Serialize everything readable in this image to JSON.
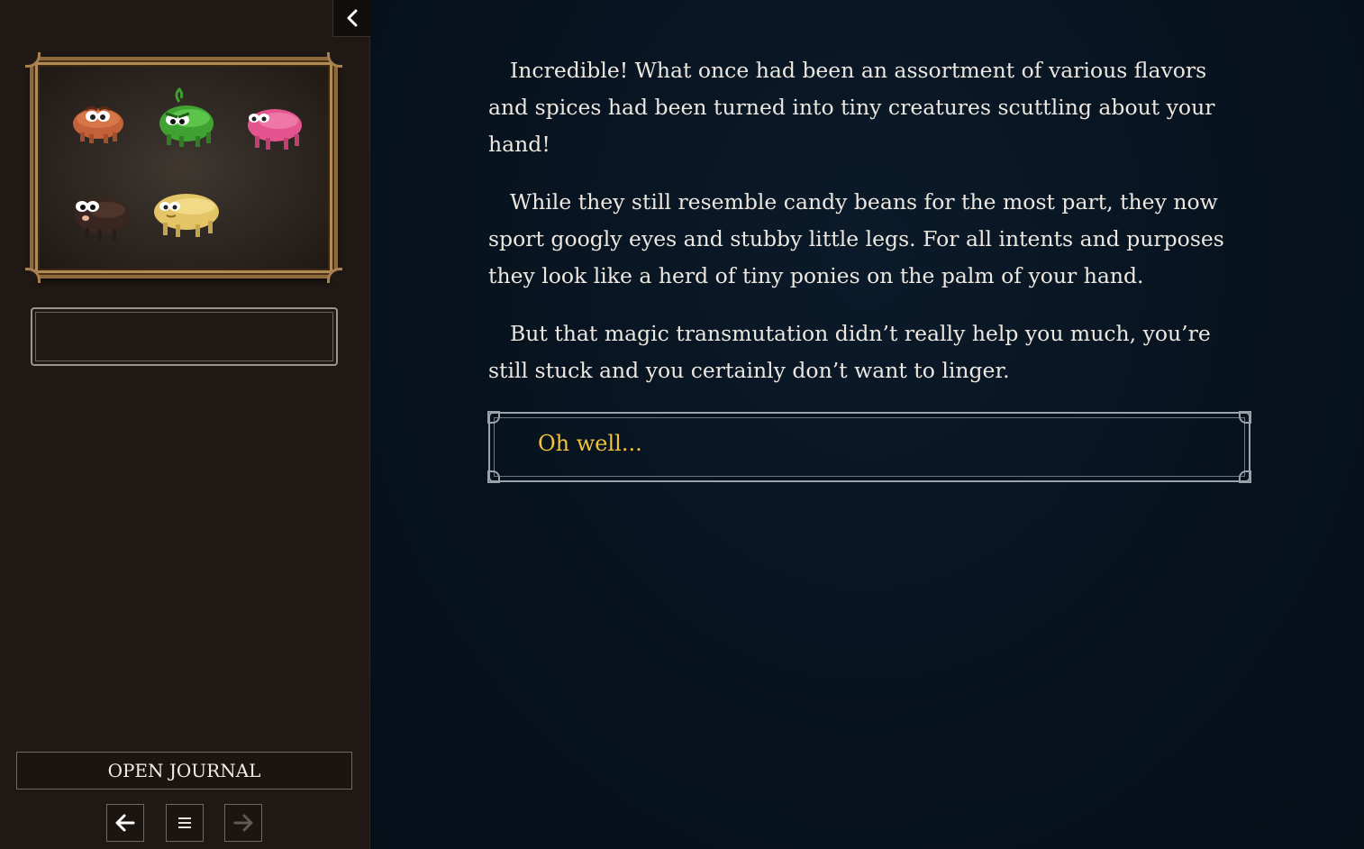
{
  "sidebar": {
    "collapse_icon": "chevron-left-icon",
    "portrait": {
      "beans": [
        {
          "name": "orange-bean-creature",
          "color": "#c2613a"
        },
        {
          "name": "green-bean-creature",
          "color": "#3fa232"
        },
        {
          "name": "pink-bean-creature",
          "color": "#e4558f"
        },
        {
          "name": "dark-bean-creature",
          "color": "#3a2620"
        },
        {
          "name": "yellow-bean-creature",
          "color": "#e3c466"
        }
      ]
    },
    "journal_label": "OPEN JOURNAL",
    "nav": {
      "back_icon": "arrow-left-icon",
      "menu_icon": "menu-icon",
      "forward_icon": "arrow-right-icon"
    }
  },
  "story": {
    "paragraphs": [
      "Incredible! What once had been an assortment of various flavors and spices had been turned into tiny creatures scuttling about your hand!",
      "While they still resemble candy beans for the most part, they now sport googly eyes and stubby little legs. For all intents and purposes they look like a herd of tiny ponies on the palm of your hand.",
      "But that magic transmutation didn’t really help you much, you’re still stuck and you certainly don’t want to linger."
    ],
    "choices": [
      {
        "label": "Oh well..."
      }
    ]
  },
  "colors": {
    "story_text": "#ece7df",
    "choice_text": "#f1c23a",
    "sidebar_bg": "#1f1814",
    "main_bg": "#07121e"
  }
}
